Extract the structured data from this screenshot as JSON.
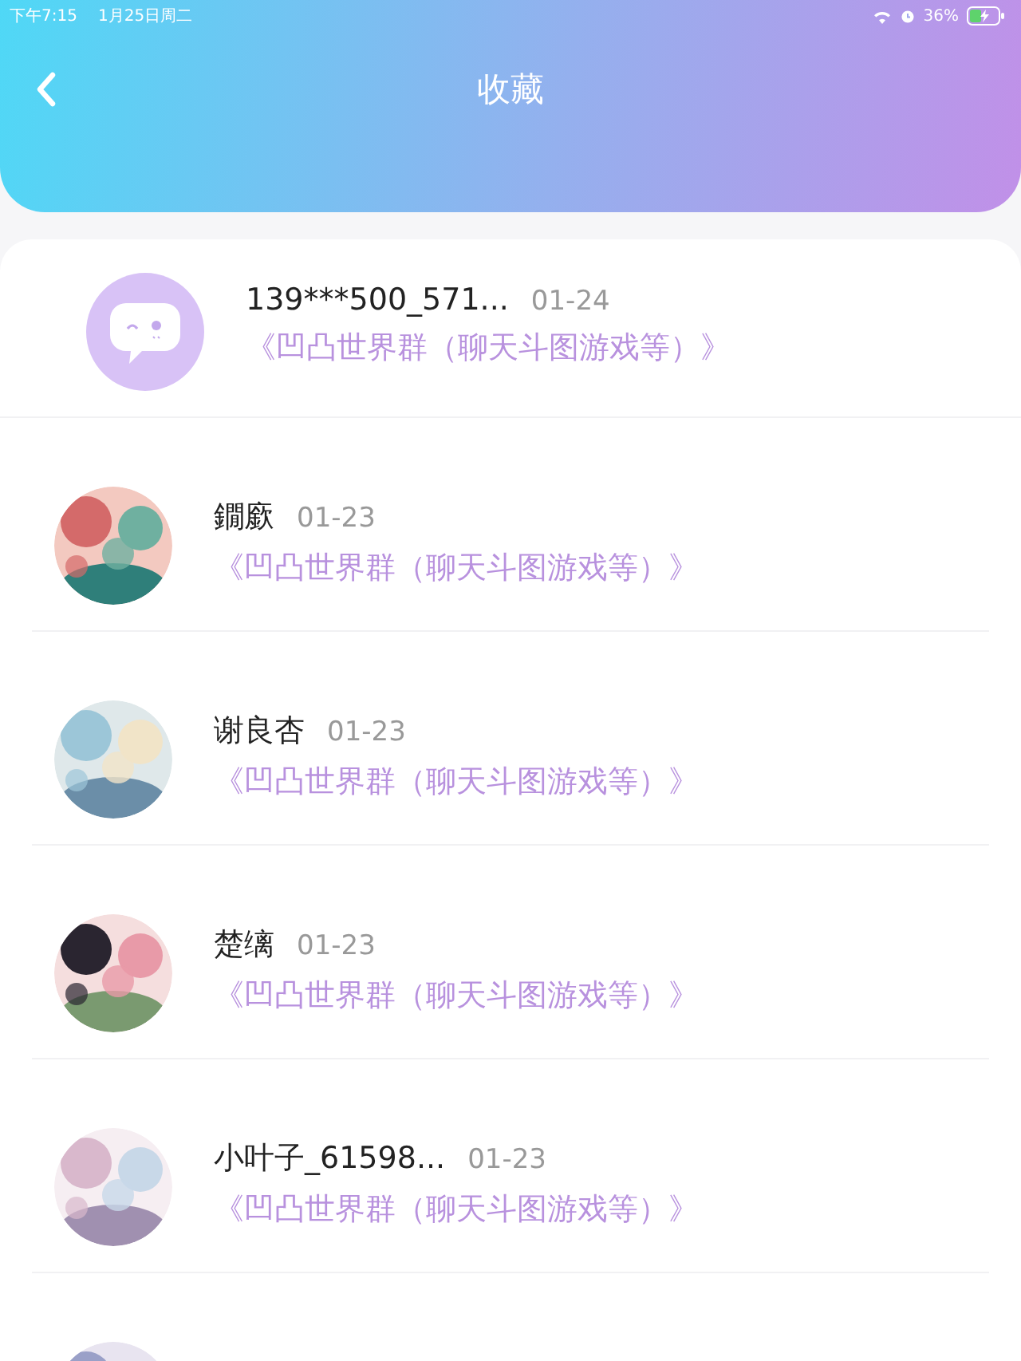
{
  "status_bar": {
    "time": "下午7:15",
    "date": "1月25日周二",
    "battery": "36%"
  },
  "header": {
    "title": "收藏"
  },
  "items": [
    {
      "kind": "logo",
      "name": "139***500_571...",
      "date": "01-24",
      "group": "《凹凸世界群（聊天斗图游戏等）》"
    },
    {
      "kind": "picture",
      "name": "鐗廞",
      "date": "01-23",
      "group": "《凹凸世界群（聊天斗图游戏等）》"
    },
    {
      "kind": "picture",
      "name": "谢良杏",
      "date": "01-23",
      "group": "《凹凸世界群（聊天斗图游戏等）》"
    },
    {
      "kind": "picture",
      "name": "楚缡",
      "date": "01-23",
      "group": "《凹凸世界群（聊天斗图游戏等）》"
    },
    {
      "kind": "picture",
      "name": "小叶子_61598...",
      "date": "01-23",
      "group": "《凹凸世界群（聊天斗图游戏等）》"
    },
    {
      "kind": "picture"
    }
  ]
}
